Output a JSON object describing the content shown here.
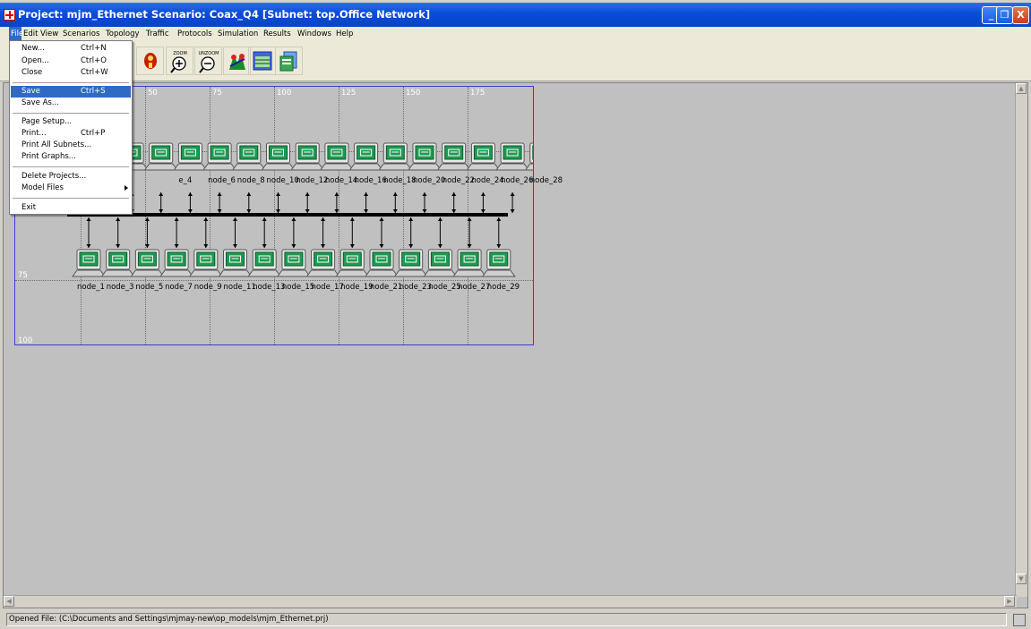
{
  "window": {
    "title": "Project: mjm_Ethernet Scenario: Coax_Q4  [Subnet: top.Office Network]",
    "minimize_label": "_",
    "maximize_label": "❐",
    "close_label": "X"
  },
  "menubar": {
    "items": [
      "File",
      "Edit",
      "View",
      "Scenarios",
      "Topology",
      "Traffic",
      "Protocols",
      "Simulation",
      "Results",
      "Windows",
      "Help"
    ]
  },
  "toolbar": {
    "buttons": [
      "object-palette-icon",
      "zoom-in-icon",
      "unzoom-icon",
      "configure-simulation-icon",
      "view-results-icon",
      "view-web-report-icon"
    ],
    "zoom_label": "ZOOM",
    "unzoom_label": "UNZOOM"
  },
  "file_menu": {
    "new": {
      "label": "New...",
      "shortcut": "Ctrl+N"
    },
    "open": {
      "label": "Open...",
      "shortcut": "Ctrl+O"
    },
    "close": {
      "label": "Close",
      "shortcut": "Ctrl+W"
    },
    "save": {
      "label": "Save",
      "shortcut": "Ctrl+S"
    },
    "save_as": {
      "label": "Save As..."
    },
    "page_setup": {
      "label": "Page Setup..."
    },
    "print": {
      "label": "Print...",
      "shortcut": "Ctrl+P"
    },
    "print_all_subnets": {
      "label": "Print All Subnets..."
    },
    "print_graphs": {
      "label": "Print Graphs..."
    },
    "delete_projects": {
      "label": "Delete Projects..."
    },
    "model_files": {
      "label": "Model Files"
    },
    "exit": {
      "label": "Exit"
    }
  },
  "canvas": {
    "ruler_top": [
      "50",
      "75",
      "100",
      "125",
      "150",
      "175"
    ],
    "ruler_left": [
      "75",
      "100"
    ],
    "top_row_labels": [
      "e_4",
      "node_6",
      "node_8",
      "node_10",
      "node_12",
      "node_14",
      "node_16",
      "node_18",
      "node_20",
      "node_22",
      "node_24",
      "node_26",
      "node_28"
    ],
    "bottom_row_labels": [
      "node_1",
      "node_3",
      "node_5",
      "node_7",
      "node_9",
      "node_11",
      "node_13",
      "node_15",
      "node_17",
      "node_19",
      "node_21",
      "node_23",
      "node_25",
      "node_27",
      "node_29"
    ]
  },
  "statusbar": {
    "text": "Opened File: (C:\\Documents and Settings\\mjmay-new\\op_models\\mjm_Ethernet.prj)"
  }
}
